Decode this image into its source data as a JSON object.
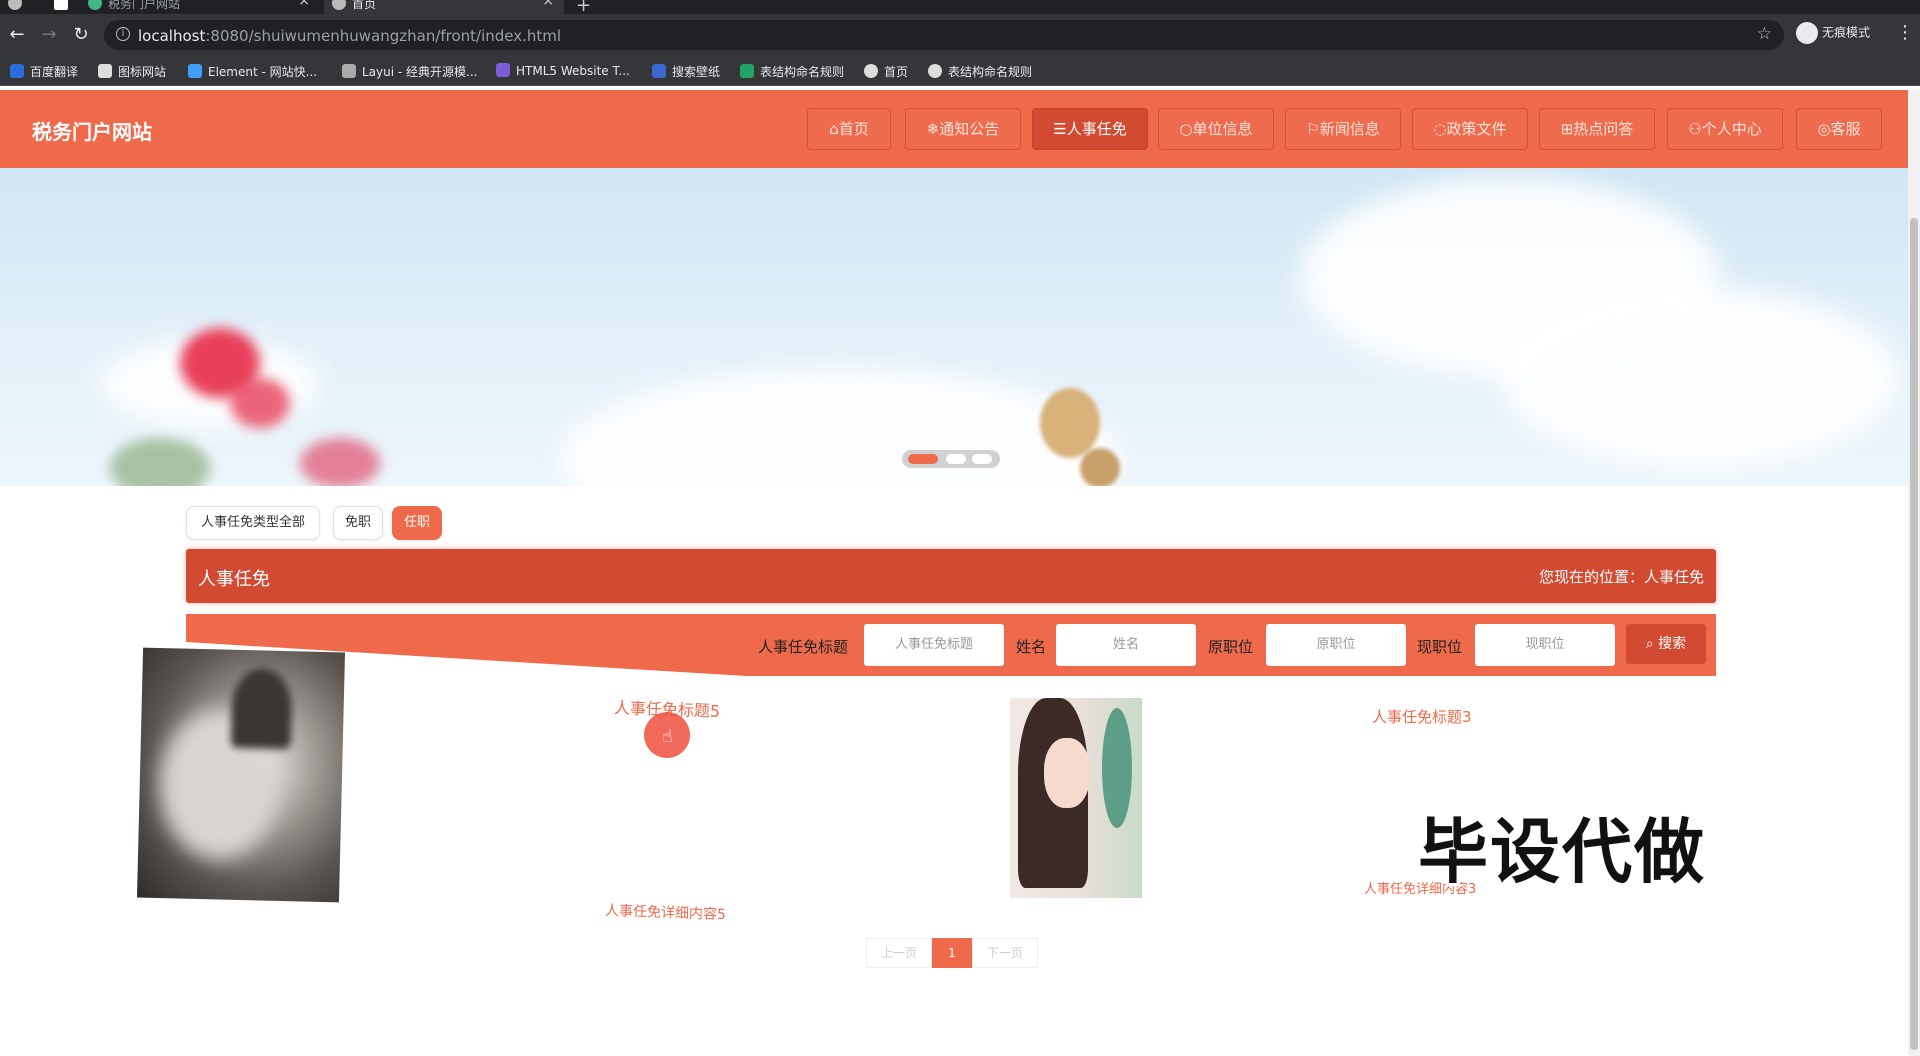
{
  "browser": {
    "tabs": [
      {
        "title": "税务门户网站",
        "active": false
      },
      {
        "title": "首页",
        "active": true
      }
    ],
    "url_host": "localhost",
    "url_path": ":8080/shuiwumenhuwangzhan/front/index.html",
    "incognito_label": "无痕模式",
    "bookmarks": [
      "百度翻译",
      "图标网站",
      "Element - 网站快...",
      "Layui - 经典开源模...",
      "HTML5 Website T...",
      "搜索壁纸",
      "表结构命名规则",
      "首页",
      "表结构命名规则"
    ]
  },
  "site": {
    "title": "税务门户网站",
    "nav": [
      {
        "label": "首页",
        "icon": "home-icon",
        "glyph": "⌂",
        "active": false
      },
      {
        "label": "通知公告",
        "icon": "snowflake-icon",
        "glyph": "❄",
        "active": false
      },
      {
        "label": "人事任免",
        "icon": "layers-icon",
        "glyph": "☰",
        "active": true
      },
      {
        "label": "单位信息",
        "icon": "circle-icon",
        "glyph": "○",
        "active": false
      },
      {
        "label": "新闻信息",
        "icon": "flag-icon",
        "glyph": "⚐",
        "active": false
      },
      {
        "label": "政策文件",
        "icon": "chat-icon",
        "glyph": "◌",
        "active": false
      },
      {
        "label": "热点问答",
        "icon": "table-icon",
        "glyph": "⊞",
        "active": false
      },
      {
        "label": "个人中心",
        "icon": "user-icon",
        "glyph": "⚇",
        "active": false
      },
      {
        "label": "客服",
        "icon": "support-icon",
        "glyph": "◎",
        "active": false
      }
    ]
  },
  "banner": {
    "slides": 3,
    "active_slide": 1
  },
  "filters": [
    {
      "label": "人事任免类型全部",
      "active": false
    },
    {
      "label": "免职",
      "active": false
    },
    {
      "label": "任职",
      "active": true
    }
  ],
  "section": {
    "title": "人事任免",
    "location_label": "您现在的位置：",
    "location_value": "人事任免"
  },
  "search": {
    "fields": [
      {
        "label": "人事任免标题",
        "placeholder": "人事任免标题"
      },
      {
        "label": "姓名",
        "placeholder": "姓名"
      },
      {
        "label": "原职位",
        "placeholder": "原职位"
      },
      {
        "label": "现职位",
        "placeholder": "现职位"
      }
    ],
    "button": "搜索"
  },
  "cards": [
    {
      "title": "人事任免标题5",
      "desc": "人事任免详细内容5",
      "image": "husky-dog-photo"
    },
    {
      "title": "人事任免标题3",
      "desc": "人事任免详细内容3",
      "image": "illustrated-woman-photo"
    }
  ],
  "watermark": "毕设代做",
  "pagination": {
    "prev": "上一页",
    "current": "1",
    "next": "下一页"
  }
}
